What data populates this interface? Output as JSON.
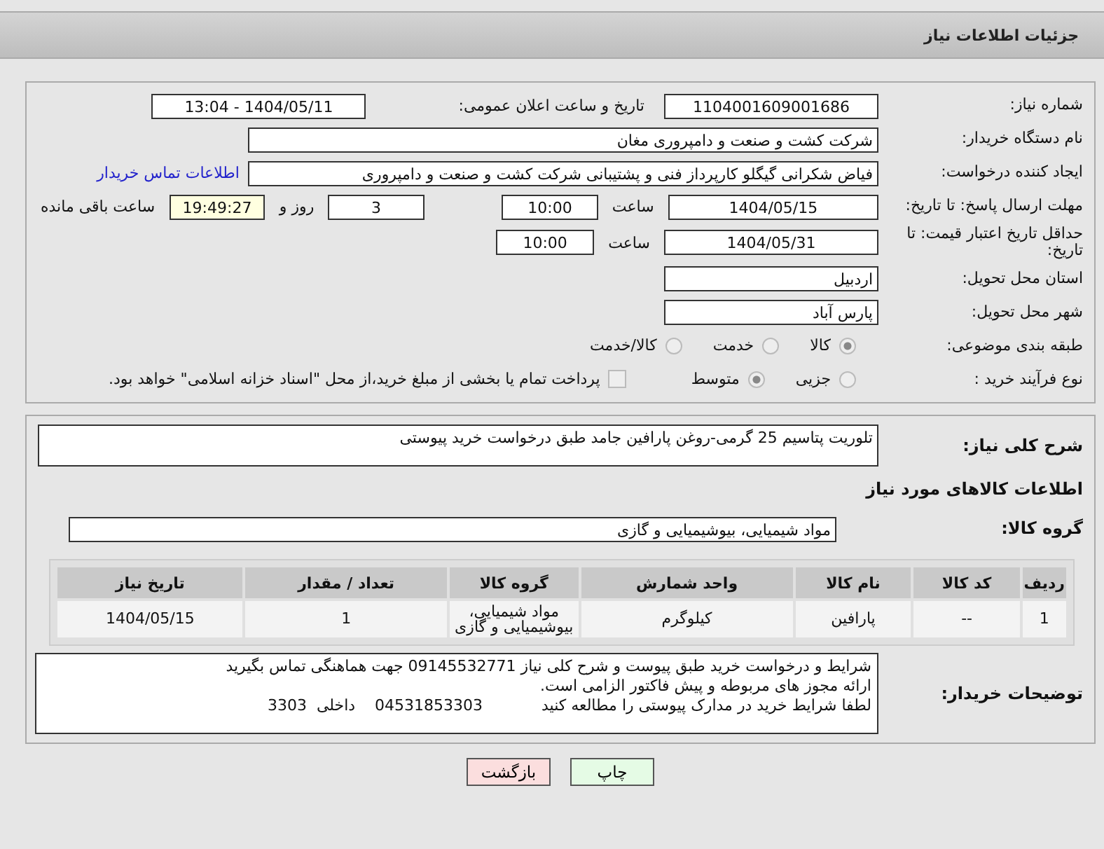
{
  "header": {
    "title": "جزئیات اطلاعات نیاز"
  },
  "need_number": {
    "label": "شماره نیاز:",
    "value": "1104001609001686"
  },
  "announce": {
    "label": "تاریخ و ساعت اعلان عمومی:",
    "value": "1404/05/11 - 13:04"
  },
  "buyer_org": {
    "label": "نام دستگاه خریدار:",
    "value": "شرکت کشت و صنعت و دامپروری مغان"
  },
  "requester": {
    "label": "ایجاد کننده درخواست:",
    "value": "فیاض شکرانی گیگلو کارپرداز فنی و پشتیبانی شرکت کشت و صنعت و دامپروری",
    "link": "اطلاعات تماس خریدار"
  },
  "deadline": {
    "label": "مهلت ارسال پاسخ: تا تاریخ:",
    "date": "1404/05/15",
    "time_label": "ساعت",
    "time": "10:00",
    "days": "3",
    "days_label": "روز و",
    "remaining": "19:49:27",
    "remaining_label": "ساعت باقی مانده"
  },
  "validity": {
    "label": "حداقل تاریخ اعتبار قیمت: تا تاریخ:",
    "date": "1404/05/31",
    "time_label": "ساعت",
    "time": "10:00"
  },
  "province": {
    "label": "استان محل تحویل:",
    "value": "اردبیل"
  },
  "city": {
    "label": "شهر محل تحویل:",
    "value": "پارس آباد"
  },
  "category": {
    "label": "طبقه بندی موضوعی:",
    "options": [
      {
        "label": "کالا",
        "selected": true
      },
      {
        "label": "خدمت",
        "selected": false
      },
      {
        "label": "کالا/خدمت",
        "selected": false
      }
    ]
  },
  "purchase_type": {
    "label": "نوع فرآیند خرید :",
    "options": [
      {
        "label": "جزیی",
        "selected": false
      },
      {
        "label": "متوسط",
        "selected": true
      }
    ],
    "payment": {
      "label": "پرداخت تمام یا بخشی از مبلغ خرید،از محل \"اسناد خزانه اسلامی\" خواهد بود.",
      "checked": false
    }
  },
  "description": {
    "label": "شرح کلی نیاز:",
    "value": "تلوریت پتاسیم 25 گرمی-روغن پارافین جامد  طبق درخواست خرید پیوستی"
  },
  "goods_title": "اطلاعات کالاهای مورد نیاز",
  "goods_group": {
    "label": "گروه کالا:",
    "value": "مواد شیمیایی، بیوشیمیایی و  گازی"
  },
  "table": {
    "columns": [
      "ردیف",
      "کد کالا",
      "نام کالا",
      "واحد شمارش",
      "گروه کالا",
      "تعداد / مقدار",
      "تاریخ نیاز"
    ],
    "rows": [
      [
        "1",
        "--",
        "پارافین",
        "کیلوگرم",
        "مواد شیمیایی، بیوشیمیایی و گازی",
        "1",
        "1404/05/15"
      ]
    ]
  },
  "buyer_notes": {
    "label": "توضیحات خریدار:",
    "lines": [
      "شرایط و درخواست خرید طبق پیوست و شرح کلی نیاز 09145532771 جهت هماهنگی تماس بگیرید",
      "ارائه مجوز های مربوطه و پیش فاکتور الزامی است.",
      "لطفا شرایط خرید در مدارک پیوستی را مطالعه کنید            04531853303    داخلی  3303"
    ]
  },
  "buttons": [
    {
      "label": "چاپ",
      "kind": "print"
    },
    {
      "label": "بازگشت",
      "kind": "back"
    }
  ]
}
